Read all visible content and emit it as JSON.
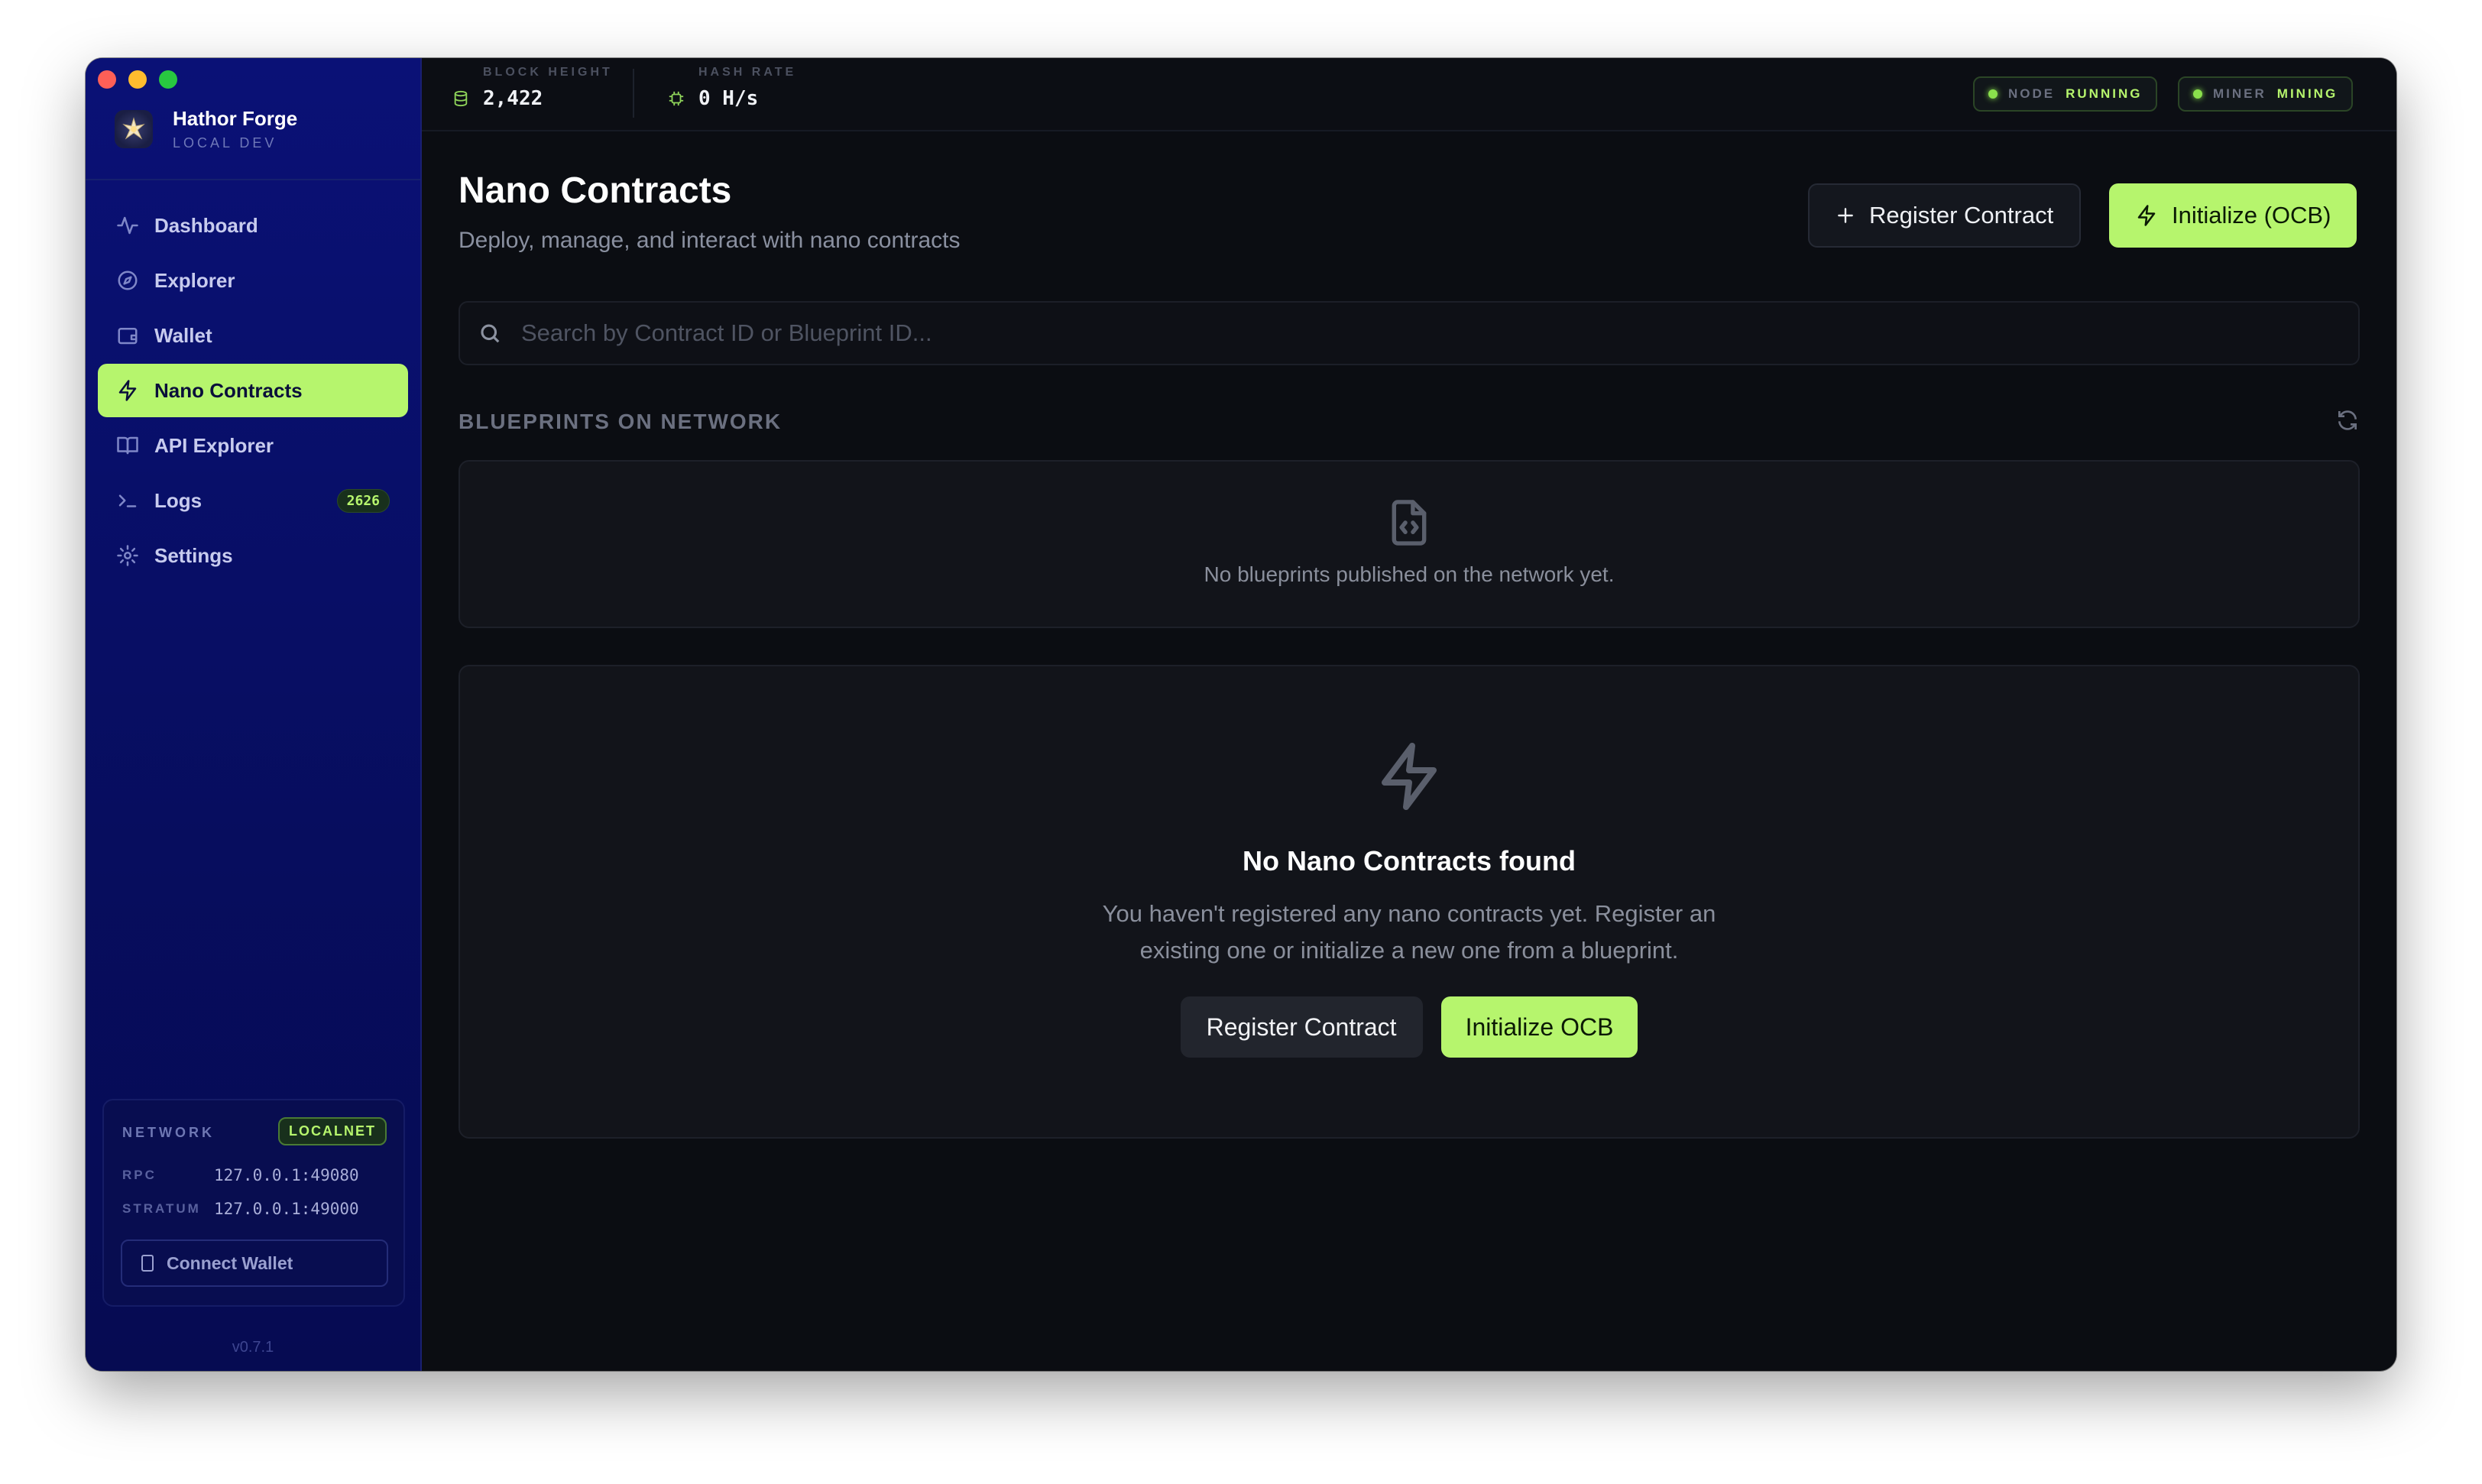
{
  "app": {
    "name": "Hathor Forge",
    "env": "LOCAL DEV",
    "version": "v0.7.1"
  },
  "sidebar": {
    "items": [
      {
        "label": "Dashboard",
        "icon": "activity-icon"
      },
      {
        "label": "Explorer",
        "icon": "compass-icon"
      },
      {
        "label": "Wallet",
        "icon": "wallet-icon"
      },
      {
        "label": "Nano Contracts",
        "icon": "lightning-icon",
        "active": true
      },
      {
        "label": "API Explorer",
        "icon": "book-icon"
      },
      {
        "label": "Logs",
        "icon": "terminal-icon",
        "badge": "2626"
      },
      {
        "label": "Settings",
        "icon": "gear-icon"
      }
    ],
    "network": {
      "label": "NETWORK",
      "value": "LOCALNET",
      "rpc_label": "RPC",
      "rpc": "127.0.0.1:49080",
      "stratum_label": "STRATUM",
      "stratum": "127.0.0.1:49000",
      "connect_label": "Connect Wallet"
    }
  },
  "topbar": {
    "block_height_label": "BLOCK HEIGHT",
    "block_height": "2,422",
    "hash_rate_label": "HASH RATE",
    "hash_rate": "0 H/s",
    "node_label": "NODE",
    "node_status": "RUNNING",
    "miner_label": "MINER",
    "miner_status": "MINING"
  },
  "main": {
    "title": "Nano Contracts",
    "subtitle": "Deploy, manage, and interact with nano contracts",
    "register_button": "Register Contract",
    "initialize_button": "Initialize (OCB)",
    "search_placeholder": "Search by Contract ID or Blueprint ID...",
    "blueprints_section": "BLUEPRINTS ON NETWORK",
    "blueprints_empty": "No blueprints published on the network yet.",
    "empty_title": "No Nano Contracts found",
    "empty_desc_line1": "You haven't registered any nano contracts yet. Register an",
    "empty_desc_line2": "existing one or initialize a new one from a blueprint.",
    "empty_register": "Register Contract",
    "empty_initialize": "Initialize OCB"
  },
  "colors": {
    "accent": "#b6f56d",
    "sidebar_bg": "#0a1176",
    "main_bg": "#0b0d12"
  }
}
